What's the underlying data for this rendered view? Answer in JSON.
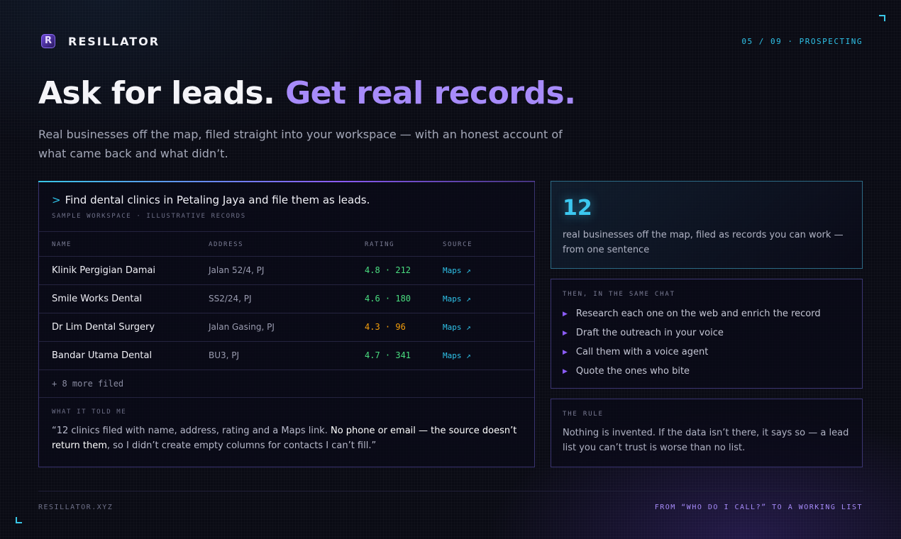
{
  "header": {
    "logo_letter": "R",
    "brand": "RESILLATOR",
    "progress": "05 / 09 · PROSPECTING"
  },
  "hero": {
    "title_a": "Ask for leads.",
    "title_b": "Get real records.",
    "subtitle": "Real businesses off the map, filed straight into your workspace — with an honest account of what came back and what didn’t."
  },
  "leads": {
    "prompt_symbol": ">",
    "prompt": "Find dental clinics in Petaling Jaya and file them as leads.",
    "caption": "SAMPLE WORKSPACE · ILLUSTRATIVE RECORDS",
    "columns": [
      "NAME",
      "ADDRESS",
      "RATING",
      "SOURCE"
    ],
    "rows": [
      {
        "name": "Klinik Pergigian Damai",
        "address": "Jalan 52/4, PJ",
        "rating": "4.8 · 212",
        "source": "Maps ↗"
      },
      {
        "name": "Smile Works Dental",
        "address": "SS2/24, PJ",
        "rating": "4.6 · 180",
        "source": "Maps ↗"
      },
      {
        "name": "Dr Lim Dental Surgery",
        "address": "Jalan Gasing, PJ",
        "rating": "4.3 · 96",
        "source": "Maps ↗"
      },
      {
        "name": "Bandar Utama Dental",
        "address": "BU3, PJ",
        "rating": "4.7 · 341",
        "source": "Maps ↗"
      }
    ],
    "more": "+ 8 more filed",
    "told_label": "WHAT IT TOLD ME",
    "quote_a": "“12 clinics filed with name, address, rating and a Maps link. ",
    "quote_b": "No phone or email — the source doesn’t return them",
    "quote_c": ", so I didn’t create empty columns for contacts I can’t fill.”"
  },
  "stat": {
    "number": "12",
    "description": "real businesses off the map, filed as records you can work — from one sentence"
  },
  "steps": {
    "label": "THEN, IN THE SAME CHAT",
    "items": [
      "Research each one on the web and enrich the record",
      "Draft the outreach in your voice",
      "Call them with a voice agent",
      "Quote the ones who bite"
    ]
  },
  "rule": {
    "label": "THE RULE",
    "body": "Nothing is invented. If the data isn’t there, it says so — a lead list you can’t trust is worse than no list."
  },
  "footer": {
    "left": "RESILLATOR.XYZ",
    "right": "FROM “WHO DO I CALL?” TO A WORKING LIST"
  },
  "colors": {
    "accent_purple": "#a78bfa",
    "accent_cyan": "#2fc2e8",
    "rating_good": "#4ade80",
    "rating_mid": "#f59e0b"
  },
  "icons": {
    "step_bullet": "triangle-right-icon",
    "external_link": "arrow-up-right-icon"
  }
}
